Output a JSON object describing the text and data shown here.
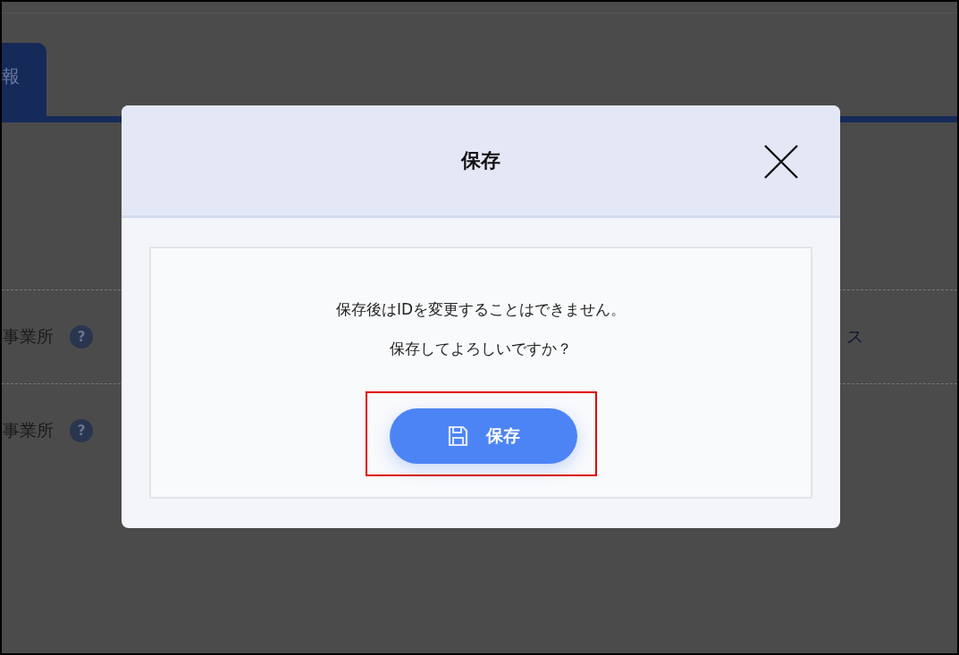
{
  "background": {
    "tabs": [
      {
        "label": "報",
        "selected": true
      }
    ],
    "rows": [
      {
        "label": "事業所",
        "help_mark": "?",
        "value": "ス"
      },
      {
        "label": "事業所",
        "help_mark": "?"
      }
    ]
  },
  "dialog": {
    "title": "保存",
    "message": [
      "保存後はIDを変更することはできません。",
      "保存してよろしいですか？"
    ],
    "button": {
      "label": "保存",
      "highlighted": true
    }
  }
}
